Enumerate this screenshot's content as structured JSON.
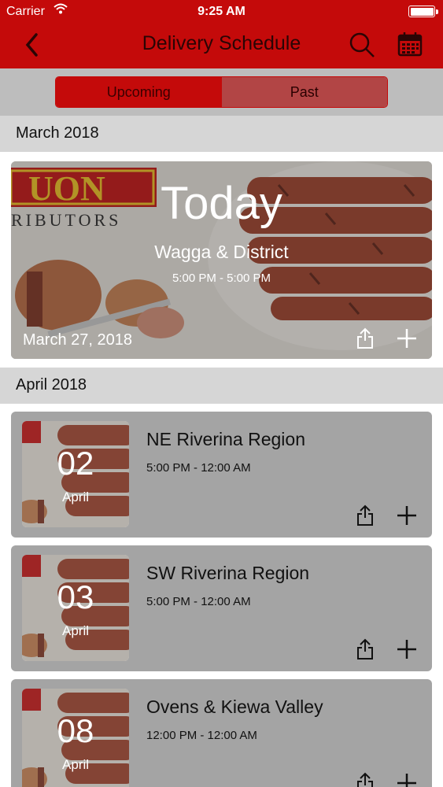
{
  "status_bar": {
    "carrier": "Carrier",
    "time": "9:25 AM"
  },
  "nav": {
    "title": "Delivery Schedule",
    "back_icon": "chevron-left-icon",
    "search_icon": "search-icon",
    "calendar_icon": "calendar-icon"
  },
  "segments": {
    "upcoming": "Upcoming",
    "past": "Past",
    "selected": "Upcoming"
  },
  "sections": [
    {
      "header": "March 2018"
    },
    {
      "header": "April 2018"
    }
  ],
  "today": {
    "brand_top": "UON",
    "brand_bottom": "RIBUTORS",
    "title": "Today",
    "region": "Wagga & District",
    "time": "5:00 PM - 5:00 PM",
    "date": "March 27, 2018"
  },
  "items": [
    {
      "day": "02",
      "month": "April",
      "region": "NE Riverina Region",
      "time": "5:00 PM - 12:00 AM"
    },
    {
      "day": "03",
      "month": "April",
      "region": "SW Riverina Region",
      "time": "5:00 PM - 12:00 AM"
    },
    {
      "day": "08",
      "month": "April",
      "region": "Ovens & Kiewa Valley",
      "time": "12:00 PM - 12:00 AM"
    }
  ],
  "colors": {
    "brand_red": "#c40a0a",
    "card_gray": "#a4a4a4"
  }
}
